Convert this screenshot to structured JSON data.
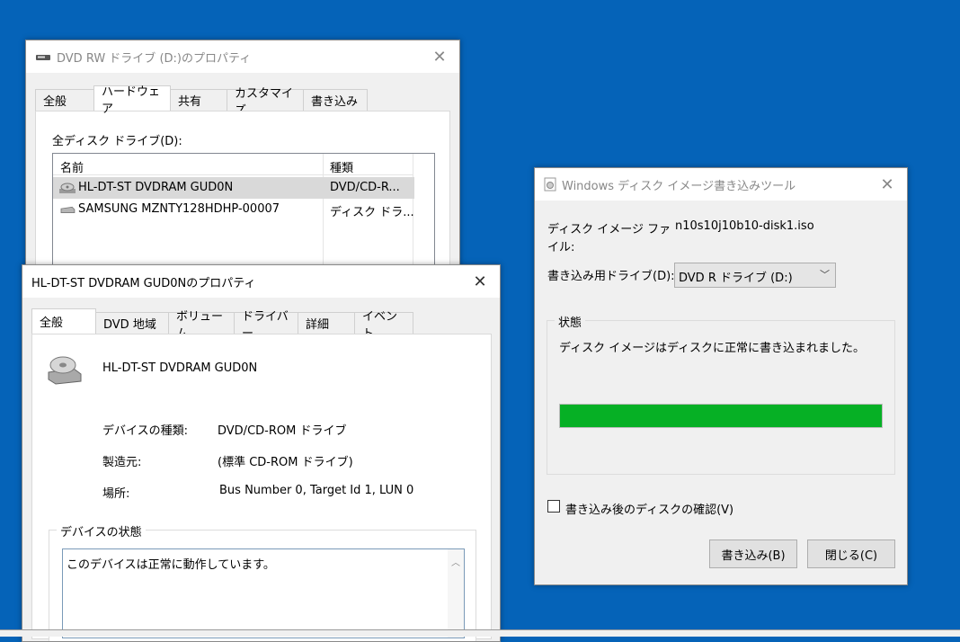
{
  "dvd_window": {
    "title": "DVD RW ドライブ (D:)のプロパティ",
    "tabs": [
      "全般",
      "ハードウェア",
      "共有",
      "カスタマイズ",
      "書き込み"
    ],
    "drives_label": "全ディスク ドライブ(D):",
    "columns": [
      "名前",
      "種類"
    ],
    "rows": [
      {
        "name": "HL-DT-ST DVDRAM GUD0N",
        "type": "DVD/CD-R..."
      },
      {
        "name": "SAMSUNG MZNTY128HDHP-00007",
        "type": "ディスク ドラ..."
      }
    ]
  },
  "device_window": {
    "title": "HL-DT-ST DVDRAM GUD0Nのプロパティ",
    "tabs": [
      "全般",
      "DVD 地域",
      "ボリューム",
      "ドライバー",
      "詳細",
      "イベント"
    ],
    "device_name": "HL-DT-ST DVDRAM GUD0N",
    "props": [
      {
        "label": "デバイスの種類:",
        "value": "DVD/CD-ROM ドライブ"
      },
      {
        "label": "製造元:",
        "value": "(標準 CD-ROM ドライブ)"
      },
      {
        "label": "場所:",
        "value": "Bus Number 0, Target Id 1, LUN 0"
      }
    ],
    "status_group": "デバイスの状態",
    "status_text": "このデバイスは正常に動作しています。"
  },
  "burn_window": {
    "title": "Windows ディスク イメージ書き込みツール",
    "file_label_1": "ディスク イメージ ファ",
    "file_label_2": "イル:",
    "file_value": "n10s10j10b10-disk1.iso",
    "drive_label": "書き込み用ドライブ(D):",
    "drive_value": "DVD R ドライブ (D:)",
    "status_group": "状態",
    "status_text": "ディスク イメージはディスクに正常に書き込まれました。",
    "progress": 100,
    "progress_color": "#06b025",
    "verify_label": "書き込み後のディスクの確認(V)",
    "verify_checked": false,
    "burn_button": "書き込み(B)",
    "close_button": "閉じる(C)"
  }
}
